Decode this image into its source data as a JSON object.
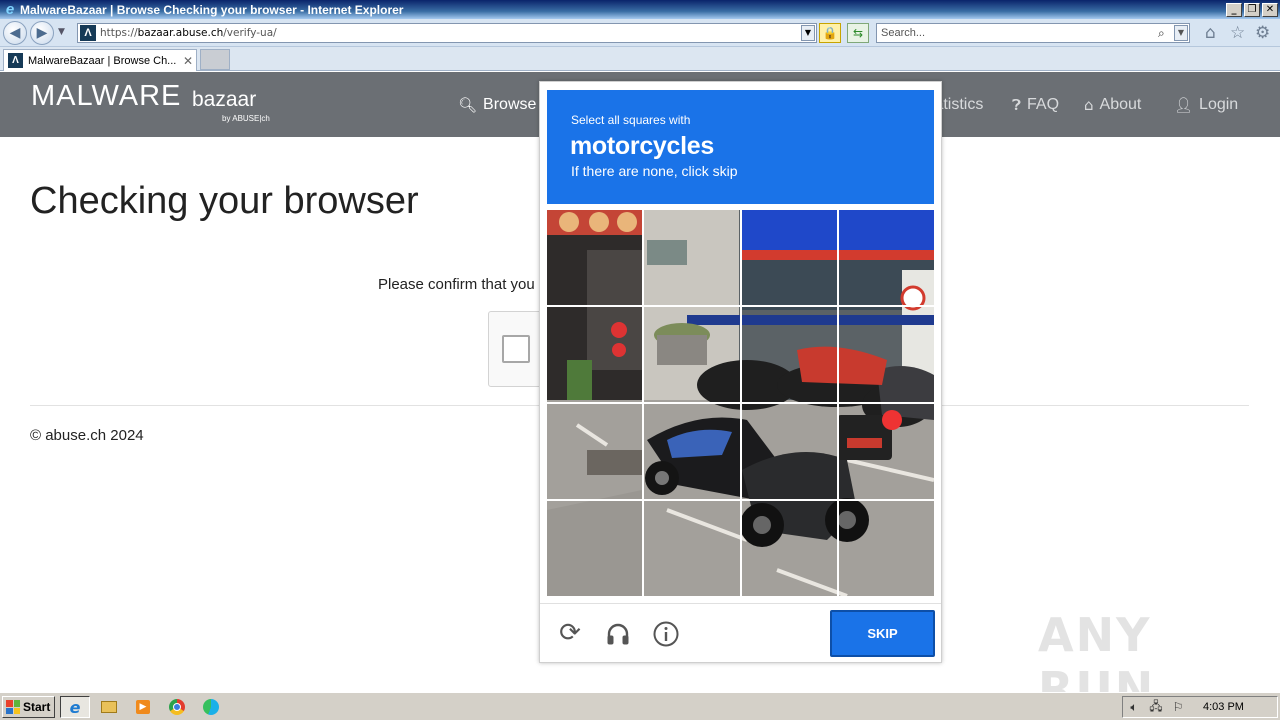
{
  "window": {
    "title": "MalwareBazaar | Browse Checking your browser - Internet Explorer",
    "controls": {
      "minimize": "_",
      "restore": "❐",
      "close": "✕"
    }
  },
  "address_bar": {
    "url_prefix": "https://",
    "url_host": "bazaar.abuse.ch",
    "url_path": "/verify-ua/",
    "search_placeholder": "Search..."
  },
  "tab": {
    "label": "MalwareBazaar | Browse Ch...",
    "close": "✕"
  },
  "site": {
    "logo_main": "MALWARE",
    "logo_sub": "bazaar",
    "logo_by": "by ABUSE|ch",
    "menu": {
      "browse": "Browse",
      "statistics": "tatistics",
      "faq": "FAQ",
      "about": "About",
      "login": "Login"
    }
  },
  "page": {
    "title": "Checking your browser",
    "confirm_text": "Please confirm that you",
    "footer": "© abuse.ch 2024"
  },
  "challenge": {
    "line1": "Select all squares with",
    "target": "motorcycles",
    "line3": "If there are none, click skip",
    "skip_label": "SKIP",
    "grid_rows": 4,
    "grid_cols": 4
  },
  "taskbar": {
    "start_label": "Start",
    "clock": "4:03 PM"
  },
  "watermark": "ANY RUN",
  "colors": {
    "challenge_blue": "#1a73e8",
    "site_header": "#6b6f74"
  }
}
